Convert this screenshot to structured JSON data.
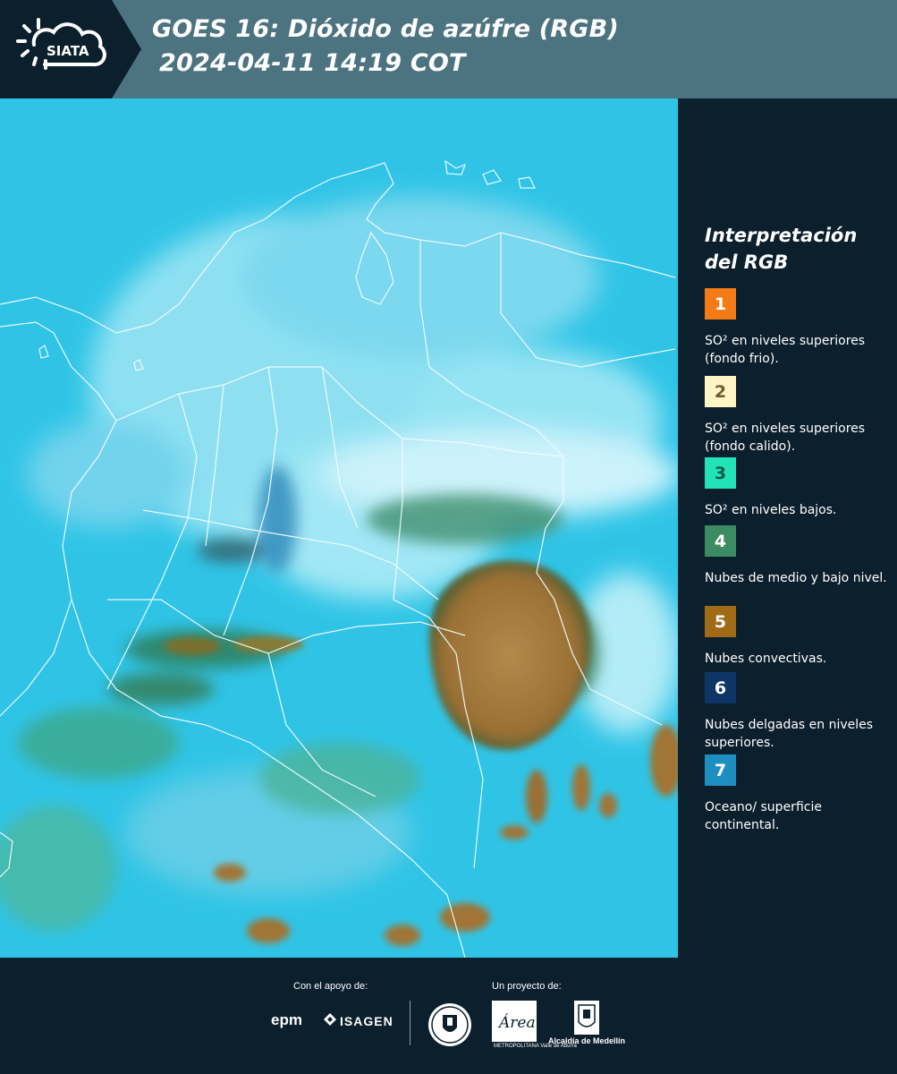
{
  "header": {
    "logo_text": "SIATA",
    "title_line1": "GOES 16: Dióxido de azúfre (RGB)",
    "title_line2": "2024-04-11 14:19 COT"
  },
  "legend": {
    "title": "Interpretación del RGB",
    "items": [
      {
        "number": "1",
        "label": "SO² en niveles superiores (fondo frio).",
        "color": "#f47b16",
        "text_color": "#ffffff"
      },
      {
        "number": "2",
        "label": "SO² en niveles superiores (fondo calido).",
        "color": "#fff5c4",
        "text_color": "#6b5d2f"
      },
      {
        "number": "3",
        "label": "SO² en niveles bajos.",
        "color": "#22e3b7",
        "text_color": "#0c5a4b"
      },
      {
        "number": "4",
        "label": "Nubes de medio y bajo nivel.",
        "color": "#3c8c62",
        "text_color": "#ffffff"
      },
      {
        "number": "5",
        "label": "Nubes convectivas.",
        "color": "#a06a16",
        "text_color": "#ffffff"
      },
      {
        "number": "6",
        "label": "Nubes delgadas en niveles superiores.",
        "color": "#0f3567",
        "text_color": "#ffffff"
      },
      {
        "number": "7",
        "label": "Oceano/ superficie continental.",
        "color": "#1c8fc0",
        "text_color": "#ffffff"
      }
    ]
  },
  "footer": {
    "support_label": "Con el apoyo de:",
    "project_label": "Un proyecto de:",
    "epm": "epm",
    "isagen": "ISAGEN",
    "area_logo": "Área",
    "area_sub": "METROPOLITANA Valle de Aburrá",
    "alcaldia": "Alcaldía de Medellín"
  },
  "colors": {
    "header_bg": "#4c7380",
    "logo_bg": "#0c1f2c",
    "panel_bg": "#0c1f2c",
    "map_ocean": "#2fc6e6",
    "map_land": "#8fe0f0",
    "convective": "#a67a35"
  }
}
